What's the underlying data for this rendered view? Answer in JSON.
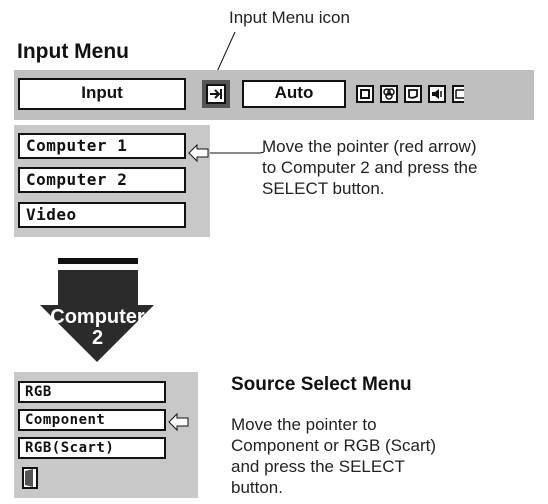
{
  "callout_icon": "Input Menu icon",
  "input_menu": {
    "title": "Input Menu",
    "menu_bar": {
      "input_label": "Input",
      "auto_label": "Auto",
      "icons": [
        "input-menu-icon",
        "square-icon",
        "color-icon",
        "screen-icon",
        "sound-icon",
        "page-icon"
      ]
    },
    "items": [
      "Computer 1",
      "Computer 2",
      "Video"
    ],
    "description": [
      "Move the pointer (red arrow)",
      "to Computer 2 and press the",
      "SELECT button."
    ]
  },
  "transition_arrow": {
    "line1": "Computer",
    "line2": "2"
  },
  "source_select": {
    "title": "Source Select Menu",
    "items": [
      "RGB",
      "Component",
      "RGB(Scart)"
    ],
    "description": [
      "Move the pointer to",
      "Component or RGB (Scart)",
      "and press the SELECT",
      "button."
    ]
  }
}
